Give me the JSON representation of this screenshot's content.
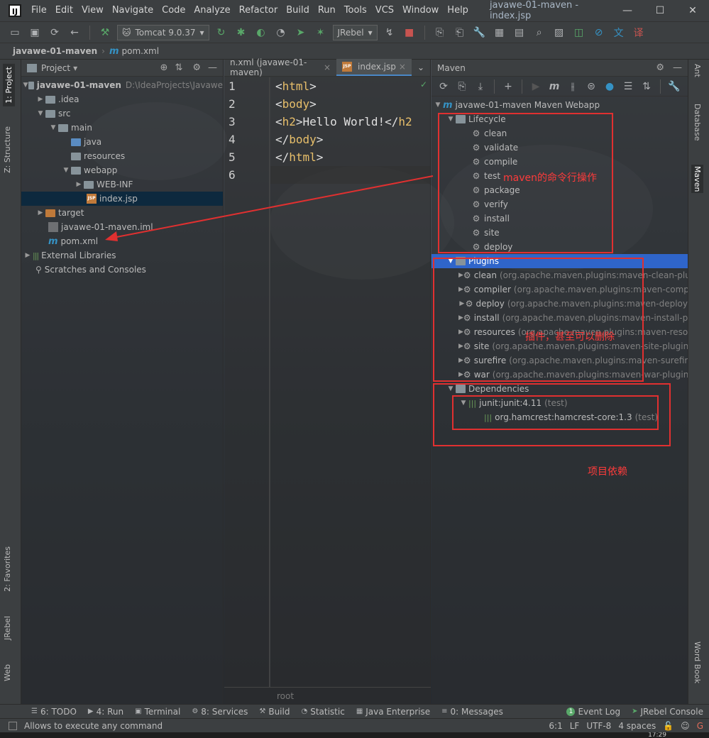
{
  "window": {
    "logo": "IJ",
    "title": "javawe-01-maven - index.jsp",
    "menu": [
      "File",
      "Edit",
      "View",
      "Navigate",
      "Code",
      "Analyze",
      "Refactor",
      "Build",
      "Run",
      "Tools",
      "VCS",
      "Window",
      "Help"
    ],
    "controls": [
      "—",
      "☐",
      "✕"
    ]
  },
  "toolbar": {
    "run_config": "Tomcat 9.0.37",
    "jrebel": "JRebel"
  },
  "breadcrumb": {
    "project": "javawe-01-maven",
    "file": "pom.xml"
  },
  "left_strip": {
    "project": "1: Project",
    "structure": "Z: Structure",
    "favorites": "2: Favorites",
    "jrebel": "JRebel",
    "web": "Web"
  },
  "right_strip": {
    "ant": "Ant",
    "database": "Database",
    "maven": "Maven",
    "word_book": "Word Book"
  },
  "project_panel": {
    "title": "Project",
    "root": "javawe-01-maven",
    "root_path": "D:\\IdeaProjects\\Javawe",
    "idea": ".idea",
    "src": "src",
    "main": "main",
    "java": "java",
    "resources": "resources",
    "webapp": "webapp",
    "web_inf": "WEB-INF",
    "index": "index.jsp",
    "target": "target",
    "iml": "javawe-01-maven.iml",
    "pom": "pom.xml",
    "external_libs": "External Libraries",
    "scratches": "Scratches and Consoles"
  },
  "editor": {
    "tab_inactive": "n.xml (javawe-01-maven)",
    "tab_active": "index.jsp",
    "line_numbers": [
      "1",
      "2",
      "3",
      "4",
      "5",
      "6"
    ],
    "lines": [
      [
        "<",
        "html",
        ">"
      ],
      [
        "<",
        "body",
        ">"
      ],
      [
        "<",
        "h2",
        ">Hello World!</",
        "h2"
      ],
      [
        "</",
        "body",
        ">"
      ],
      [
        "</",
        "html",
        ">"
      ]
    ],
    "breadcrumb": "root"
  },
  "maven": {
    "title": "Maven",
    "project": "javawe-01-maven Maven Webapp",
    "lifecycle_label": "Lifecycle",
    "lifecycle": [
      "clean",
      "validate",
      "compile",
      "test",
      "package",
      "verify",
      "install",
      "site",
      "deploy"
    ],
    "plugins_label": "Plugins",
    "plugins": [
      {
        "name": "clean",
        "detail": "(org.apache.maven.plugins:maven-clean-plu"
      },
      {
        "name": "compiler",
        "detail": "(org.apache.maven.plugins:maven-comp"
      },
      {
        "name": "deploy",
        "detail": "(org.apache.maven.plugins:maven-deploy"
      },
      {
        "name": "install",
        "detail": "(org.apache.maven.plugins:maven-install-p"
      },
      {
        "name": "resources",
        "detail": "(org.apache.maven.plugins:maven-reso"
      },
      {
        "name": "site",
        "detail": "(org.apache.maven.plugins:maven-site-plugin"
      },
      {
        "name": "surefire",
        "detail": "(org.apache.maven.plugins:maven-surefir"
      },
      {
        "name": "war",
        "detail": "(org.apache.maven.plugins:maven-war-plugin"
      }
    ],
    "dependencies_label": "Dependencies",
    "dep1_name": "junit:junit:4.11",
    "dep1_scope": "(test)",
    "dep2_name": "org.hamcrest:hamcrest-core:1.3",
    "dep2_scope": "(test)"
  },
  "annotations": {
    "lifecycle_note": "maven的命令行操作",
    "plugins_note": "插件，甚至可以删除",
    "deps_note": "项目依赖"
  },
  "bottom_bar": {
    "todo": "6: TODO",
    "run": "4: Run",
    "terminal": "Terminal",
    "services": "8: Services",
    "build": "Build",
    "statistic": "Statistic",
    "java_enterprise": "Java Enterprise",
    "messages": "0: Messages",
    "event_log": "Event Log",
    "jrebel_console": "JRebel Console",
    "event_count": "1"
  },
  "status_bar": {
    "message": "Allows to execute any command",
    "position": "6:1",
    "line_sep": "LF",
    "encoding": "UTF-8",
    "indent": "4 spaces",
    "clock": "17:29"
  },
  "colors": {
    "accent_red": "#e03030",
    "selection_blue": "#2f65ca",
    "tag_orange": "#e8bf6a"
  }
}
